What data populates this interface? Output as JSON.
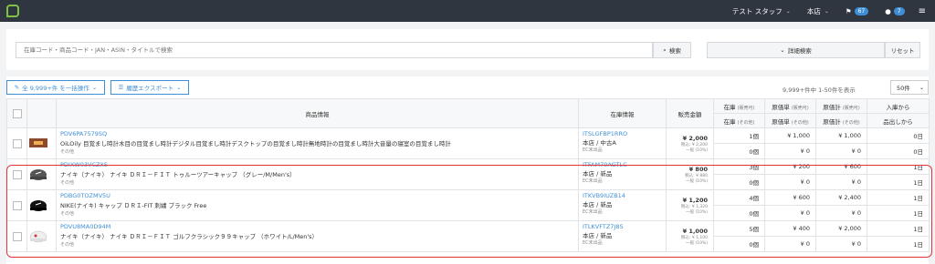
{
  "nav": {
    "user": "テスト スタッフ",
    "store": "本店",
    "flag_count": "67",
    "chat_count": "7"
  },
  "search": {
    "placeholder": "在庫コード・商品コード・JAN・ASIN・タイトルで検索",
    "button": "検索",
    "detail_button": "詳細検索",
    "reset_button": "リセット"
  },
  "toolbar": {
    "bulk_label": "全 9,999+件 を一括操作",
    "export_label": "履歴エクスポート",
    "count_text": "9,999+件中 1-50件を表示",
    "per_page": "50件"
  },
  "table": {
    "headers": {
      "product": "商品情報",
      "stock_info": "在庫情報",
      "price": "販売金額",
      "stock_top": "在庫",
      "stock_top_small": "(販売可)",
      "stock_bottom": "在庫",
      "stock_bottom_small": "(その他)",
      "cost_top": "原価単",
      "cost_top_small": "(販売可)",
      "cost_bottom": "原価単",
      "cost_bottom_small": "(その他)",
      "total_top": "原価計",
      "total_top_small": "(販売可)",
      "total_bottom": "原価計",
      "total_bottom_small": "(その他)",
      "days_top": "入庫から",
      "days_bottom": "品出しから"
    },
    "rows": [
      {
        "code": "PDV6PA7579SQ",
        "name": "OiLOily 目覚まし時計木目の目覚まし時計デジタル目覚まし時計デスクトップの目覚まし時計無地時計の目覚まし時計大音量の寝室の目覚まし時計",
        "sub": "その他",
        "stock_code": "ITSLGFBP1RRO",
        "stock_status": "本店 / 中古A",
        "stock_sub": "EC未出品",
        "price": "¥ 2,000",
        "price_tax": "税込: ¥ 2,200",
        "price_note": "一般 (10%)",
        "qty_a": "1個",
        "qty_b": "0個",
        "cost_a": "¥ 1,000",
        "cost_b": "¥ 0",
        "total_a": "¥ 1,000",
        "total_b": "¥ 0",
        "days_a": "0日",
        "days_b": "0日"
      },
      {
        "code": "PDIXW03VCZXS",
        "name": "ナイキ（ナイキ） ナイキ ＤＲＩ－ＦＩＴ トゥルーツアーキャップ （グレー/M/Men's）",
        "sub": "その他",
        "stock_code": "ITFAM70AGTLC",
        "stock_status": "本店 / 新品",
        "stock_sub": "EC未出品",
        "price": "¥ 800",
        "price_tax": "税込: ¥ 880",
        "price_note": "一般 (10%)",
        "qty_a": "3個",
        "qty_b": "0個",
        "cost_a": "¥ 200",
        "cost_b": "¥ 0",
        "total_a": "¥ 600",
        "total_b": "¥ 0",
        "days_a": "1日",
        "days_b": "1日"
      },
      {
        "code": "PDBG0TOZMV5U",
        "name": "NIKE(ナイキ) キャップ ＤＲＩ-FIT 刺繍 ブラック Free",
        "sub": "その他",
        "stock_code": "ITKVB9IUZB14",
        "stock_status": "本店 / 新品",
        "stock_sub": "EC未出品",
        "price": "¥ 1,200",
        "price_tax": "税込: ¥ 1,320",
        "price_note": "一般 (10%)",
        "qty_a": "4個",
        "qty_b": "0個",
        "cost_a": "¥ 600",
        "cost_b": "¥ 0",
        "total_a": "¥ 2,400",
        "total_b": "¥ 0",
        "days_a": "1日",
        "days_b": "1日"
      },
      {
        "code": "PDVU8MA0D94M",
        "name": "ナイキ（ナイキ） ナイキ ＤＲＩ－ＦＩＴ ゴルフクラシック９９キャップ （ホワイト/L/Men's）",
        "sub": "その他",
        "stock_code": "ITLKVFTZ7J8S",
        "stock_status": "本店 / 新品",
        "stock_sub": "EC未出品",
        "price": "¥ 1,000",
        "price_tax": "税込: ¥ 1,100",
        "price_note": "一般 (10%)",
        "qty_a": "5個",
        "qty_b": "0個",
        "cost_a": "¥ 400",
        "cost_b": "¥ 0",
        "total_a": "¥ 2,000",
        "total_b": "¥ 0",
        "days_a": "1日",
        "days_b": "1日"
      }
    ]
  }
}
